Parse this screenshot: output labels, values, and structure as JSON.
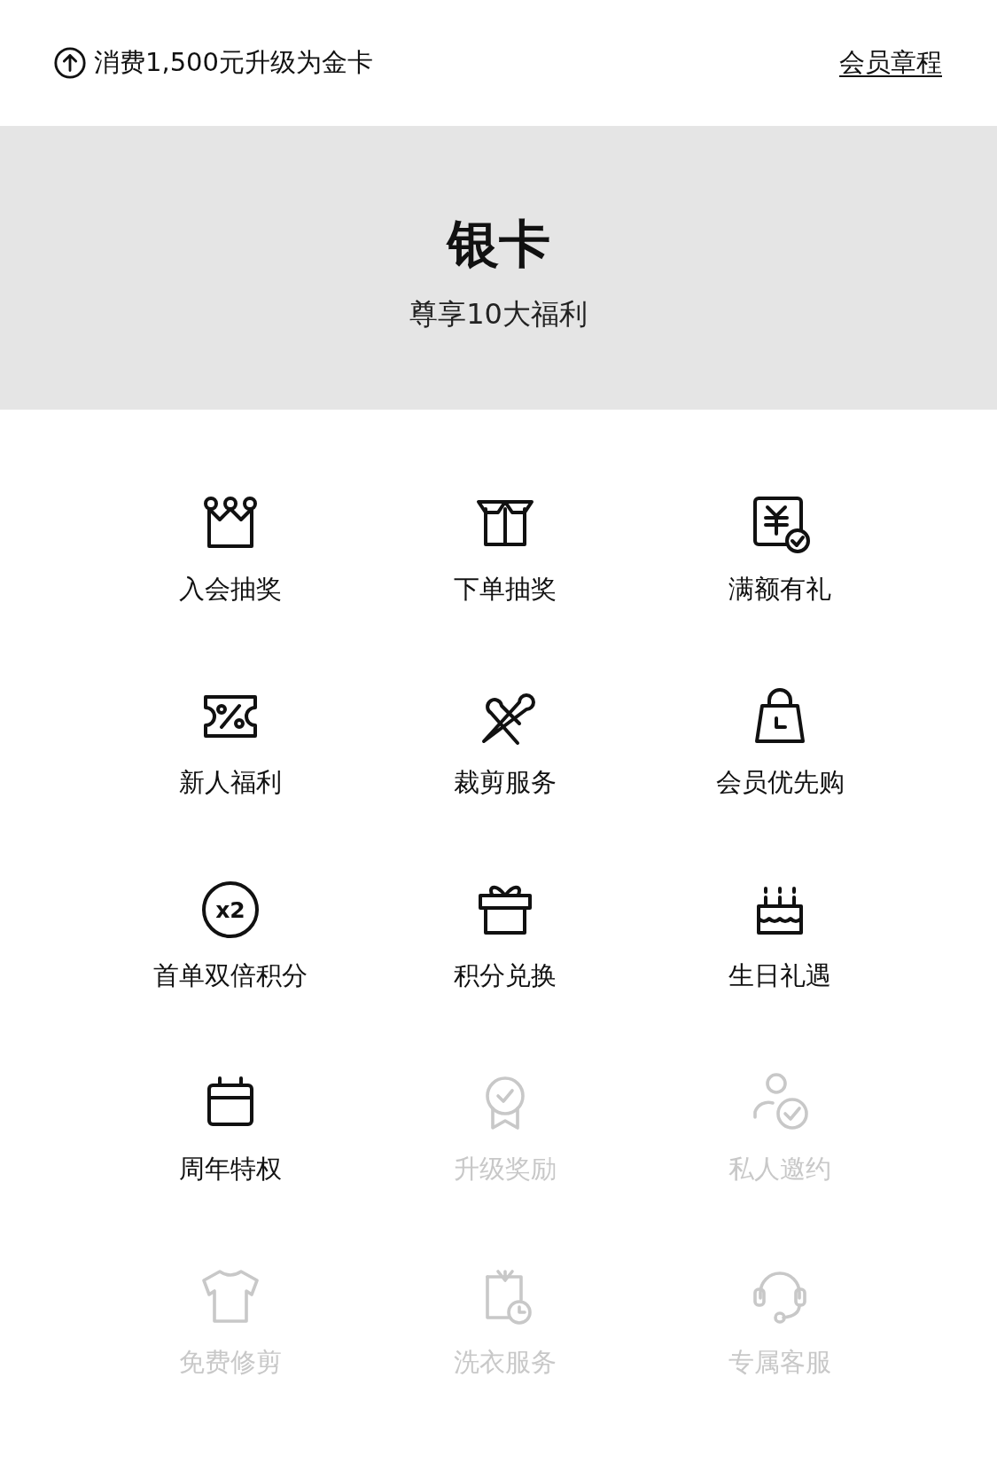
{
  "top_bar": {
    "upgrade_text": "消费1,500元升级为金卡",
    "rules_link": "会员章程"
  },
  "banner": {
    "title": "银卡",
    "subtitle": "尊享10大福利"
  },
  "benefits": [
    {
      "label": "入会抽奖",
      "disabled": false
    },
    {
      "label": "下单抽奖",
      "disabled": false
    },
    {
      "label": "满额有礼",
      "disabled": false
    },
    {
      "label": "新人福利",
      "disabled": false
    },
    {
      "label": "裁剪服务",
      "disabled": false
    },
    {
      "label": "会员优先购",
      "disabled": false
    },
    {
      "icon_text": "x2",
      "label": "首单双倍积分",
      "disabled": false
    },
    {
      "label": "积分兑换",
      "disabled": false
    },
    {
      "label": "生日礼遇",
      "disabled": false
    },
    {
      "label": "周年特权",
      "disabled": false
    },
    {
      "label": "升级奖励",
      "disabled": true
    },
    {
      "label": "私人邀约",
      "disabled": true
    },
    {
      "label": "免费修剪",
      "disabled": true
    },
    {
      "label": "洗衣服务",
      "disabled": true
    },
    {
      "label": "专属客服",
      "disabled": true
    }
  ]
}
